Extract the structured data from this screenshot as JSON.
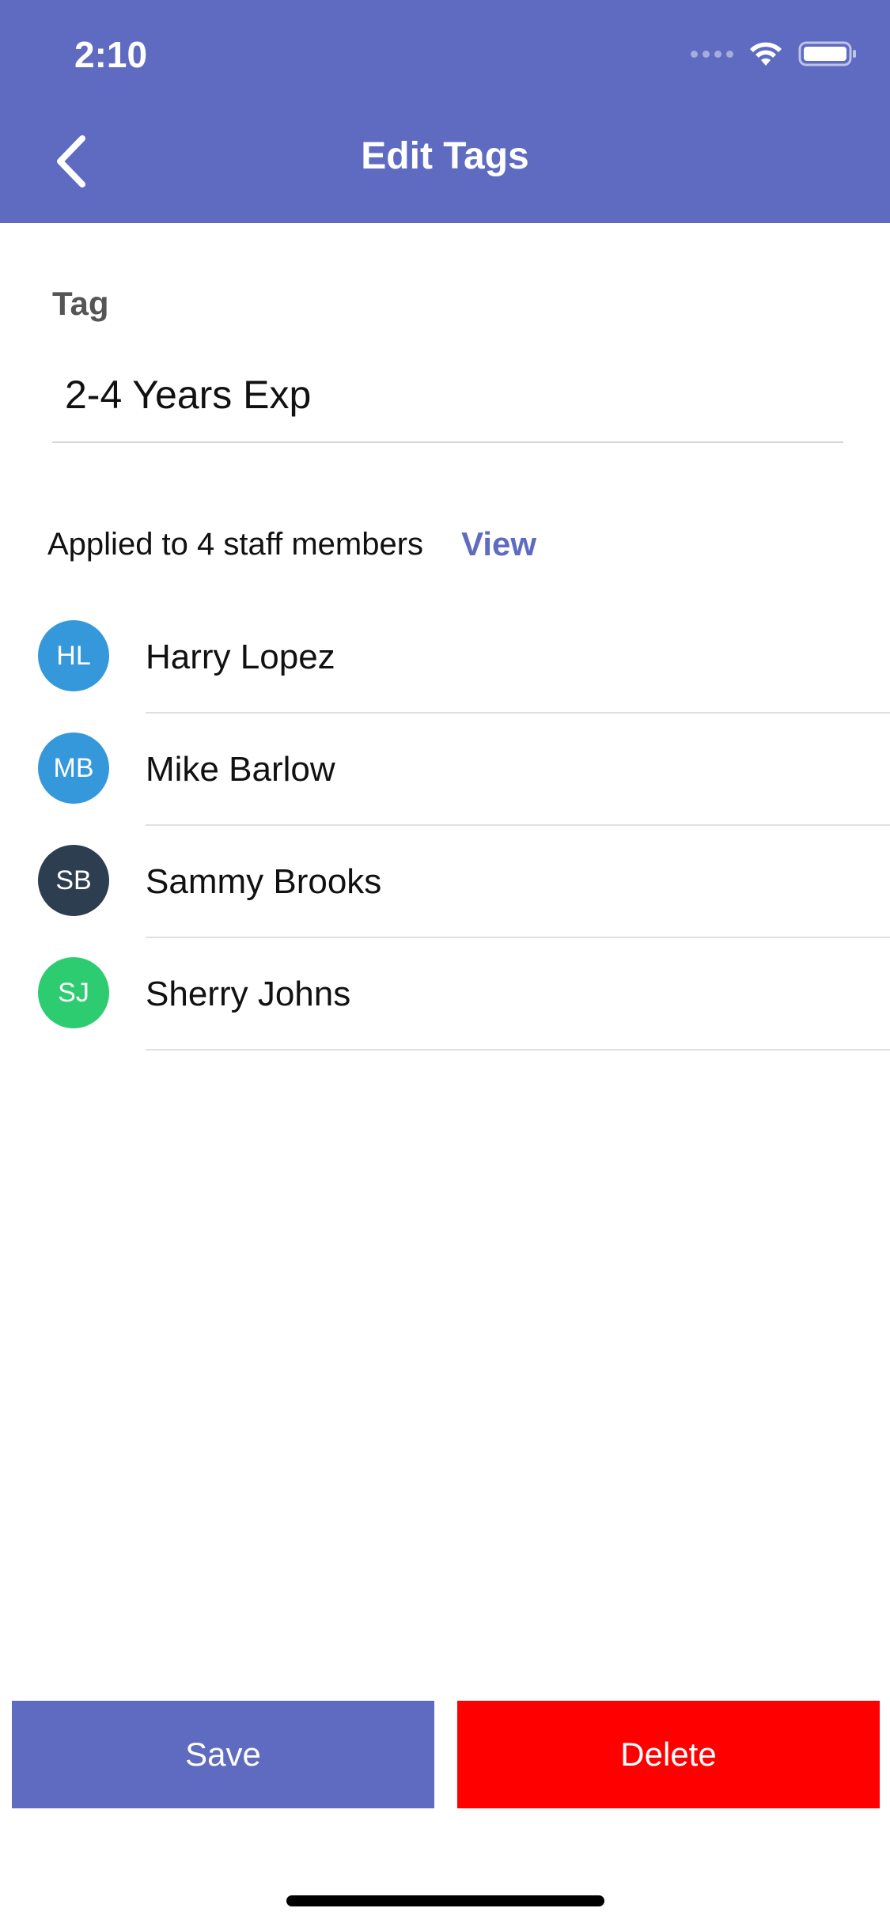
{
  "status_bar": {
    "time": "2:10"
  },
  "header": {
    "title": "Edit Tags",
    "back_icon": "chevron-left-icon",
    "background_color": "#5e6bc0"
  },
  "tag_field": {
    "label": "Tag",
    "value": "2-4 Years Exp"
  },
  "applied": {
    "text": "Applied to 4 staff members",
    "view_label": "View"
  },
  "staff": [
    {
      "initials": "HL",
      "name": "Harry Lopez",
      "color": "#3498db"
    },
    {
      "initials": "MB",
      "name": "Mike Barlow",
      "color": "#3498db"
    },
    {
      "initials": "SB",
      "name": "Sammy Brooks",
      "color": "#2c3e50"
    },
    {
      "initials": "SJ",
      "name": "Sherry Johns",
      "color": "#2ecc71"
    }
  ],
  "actions": {
    "save_label": "Save",
    "delete_label": "Delete",
    "save_color": "#5e6bc0",
    "delete_color": "#ff0000"
  }
}
